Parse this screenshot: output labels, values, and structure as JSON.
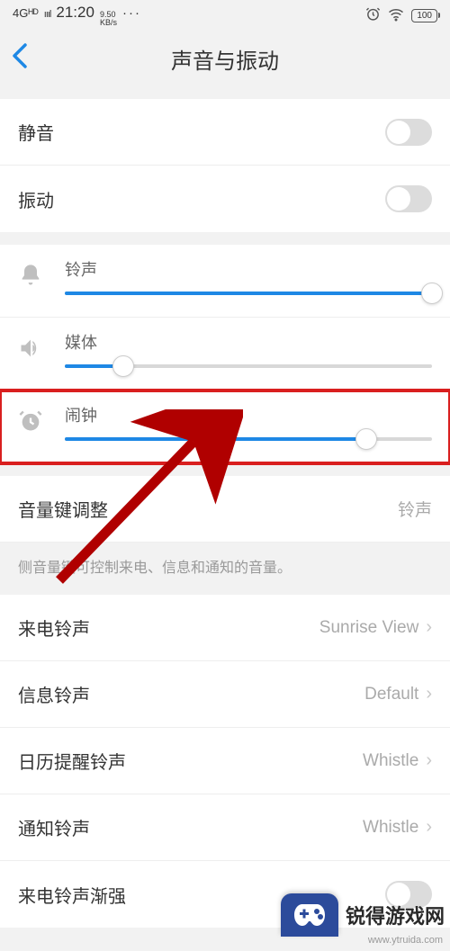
{
  "status_bar": {
    "network": "4Gᴴᴰ",
    "signal": "ıııl",
    "time": "21:20",
    "speed_top": "9.50",
    "speed_bottom": "KB/s",
    "dots": "···",
    "battery": "100"
  },
  "header": {
    "title": "声音与振动"
  },
  "toggles": {
    "mute": {
      "label": "静音",
      "on": false
    },
    "vibrate": {
      "label": "振动",
      "on": false
    }
  },
  "sliders": {
    "ringtone": {
      "label": "铃声",
      "value": 100
    },
    "media": {
      "label": "媒体",
      "value": 16
    },
    "alarm": {
      "label": "闹钟",
      "value": 82
    }
  },
  "volume_key": {
    "label": "音量键调整",
    "value": "铃声",
    "desc": "侧音量键可控制来电、信息和通知的音量。"
  },
  "ringtones": {
    "incoming": {
      "label": "来电铃声",
      "value": "Sunrise View"
    },
    "message": {
      "label": "信息铃声",
      "value": "Default"
    },
    "calendar": {
      "label": "日历提醒铃声",
      "value": "Whistle"
    },
    "notification": {
      "label": "通知铃声",
      "value": "Whistle"
    },
    "crescendo": {
      "label": "来电铃声渐强"
    }
  },
  "watermark": {
    "brand": "锐得游戏网",
    "url": "www.ytruida.com"
  }
}
